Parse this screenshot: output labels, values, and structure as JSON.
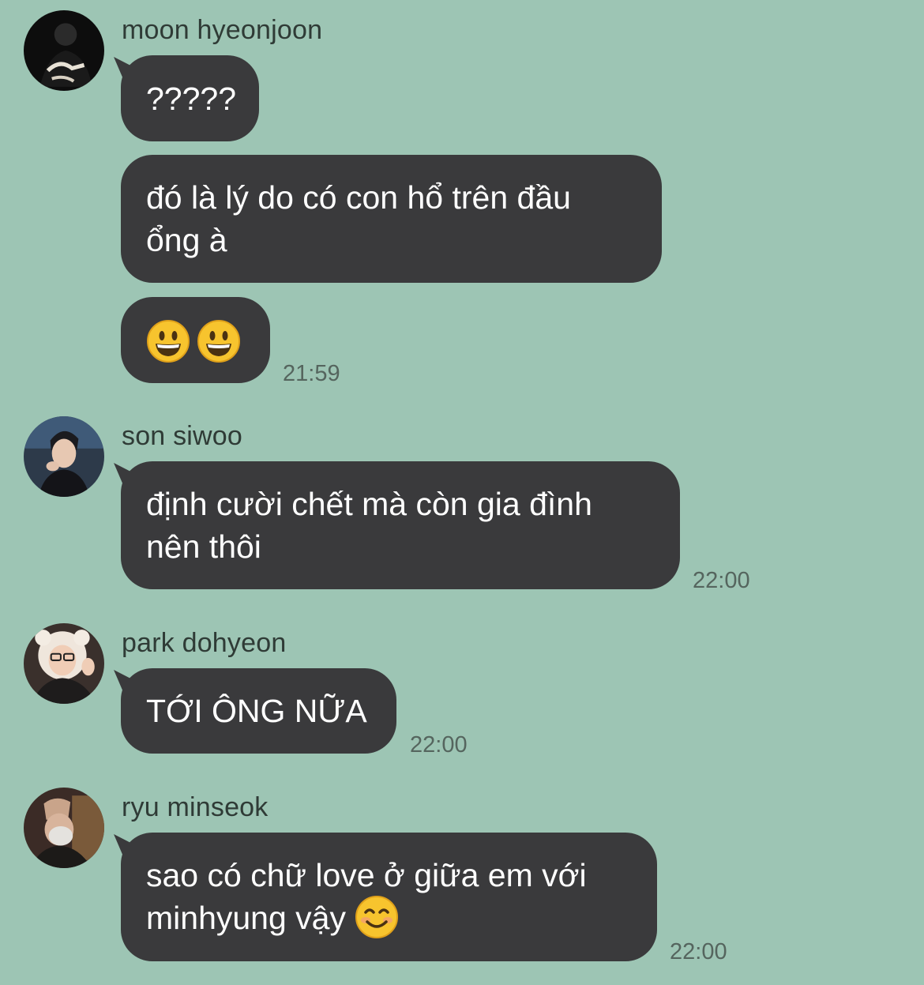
{
  "messages": [
    {
      "sender": "moon hyeonjoon",
      "avatar_icon": "avatar-moon-hyeonjoon",
      "bubbles": [
        {
          "text": "?????"
        },
        {
          "text": "đó là lý do có con hổ trên đầu\nổng à"
        },
        {
          "text": "",
          "emojis": [
            "grinning-face-icon",
            "grinning-face-icon"
          ]
        }
      ],
      "time": "21:59"
    },
    {
      "sender": "son siwoo",
      "avatar_icon": "avatar-son-siwoo",
      "bubbles": [
        {
          "text": "định cười chết mà còn gia đình\nnên thôi"
        }
      ],
      "time": "22:00"
    },
    {
      "sender": "park dohyeon",
      "avatar_icon": "avatar-park-dohyeon",
      "bubbles": [
        {
          "text": "TỚI ÔNG NỮA"
        }
      ],
      "time": "22:00"
    },
    {
      "sender": "ryu minseok",
      "avatar_icon": "avatar-ryu-minseok",
      "bubbles": [
        {
          "text": "sao có chữ love ở giữa em với\nminhyung vậy",
          "trailing_emoji": "smiling-face-icon"
        }
      ],
      "time": "22:00"
    }
  ],
  "colors": {
    "background": "#9dc5b4",
    "bubble": "#3a3a3c",
    "bubble_text": "#ffffff",
    "timestamp": "#55655e"
  }
}
